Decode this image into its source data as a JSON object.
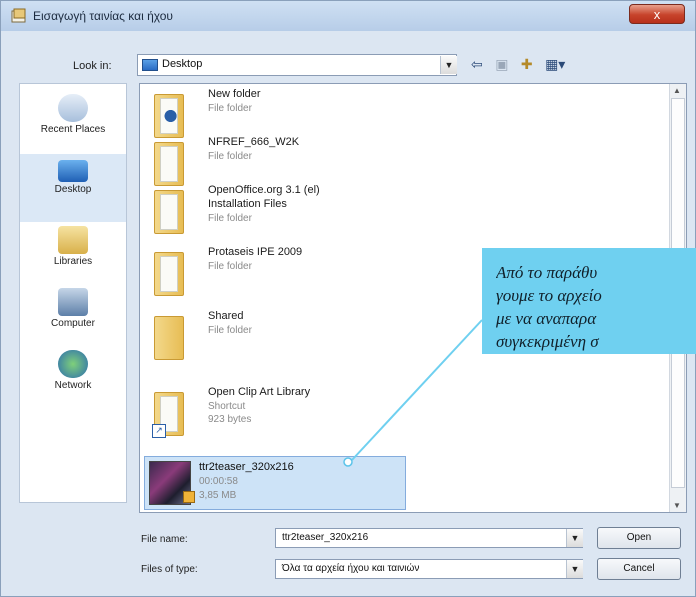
{
  "window": {
    "title": "Εισαγωγή ταινίας και ήχου",
    "close_label": "x"
  },
  "toolbar": {
    "lookin_label": "Look in:",
    "lookin_value": "Desktop"
  },
  "places": [
    {
      "label": "Recent Places",
      "icon": "recent-places-icon"
    },
    {
      "label": "Desktop",
      "icon": "desktop-icon"
    },
    {
      "label": "Libraries",
      "icon": "libraries-icon"
    },
    {
      "label": "Computer",
      "icon": "computer-icon"
    },
    {
      "label": "Network",
      "icon": "network-icon"
    }
  ],
  "files": [
    {
      "name": "New folder",
      "detail1": "File folder",
      "detail2": ""
    },
    {
      "name": "NFREF_666_W2K",
      "detail1": "File folder",
      "detail2": ""
    },
    {
      "name": "OpenOffice.org 3.1 (el)",
      "name2": "Installation Files",
      "detail1": "File folder",
      "detail2": ""
    },
    {
      "name": "Protaseis IPE 2009",
      "detail1": "File folder",
      "detail2": ""
    },
    {
      "name": "Shared",
      "detail1": "File folder",
      "detail2": ""
    },
    {
      "name": "Open Clip Art Library",
      "detail1": "Shortcut",
      "detail2": "923 bytes"
    },
    {
      "name": "ttr2teaser_320x216",
      "detail1": "00:00:58",
      "detail2": "3,85 MB"
    }
  ],
  "form": {
    "filename_label": "File name:",
    "filename_value": "ttr2teaser_320x216",
    "filetype_label": "Files of type:",
    "filetype_value": "Όλα τα αρχεία ήχου και ταινιών",
    "open_label": "Open",
    "cancel_label": "Cancel"
  },
  "callout": {
    "lines": [
      "Από το παράθυ",
      "γουμε το αρχείο",
      "με να αναπαρα",
      "συγκεκριμένη σ"
    ]
  },
  "colors": {
    "callout": "#6fd0f0",
    "selection": "#cde3f7"
  }
}
